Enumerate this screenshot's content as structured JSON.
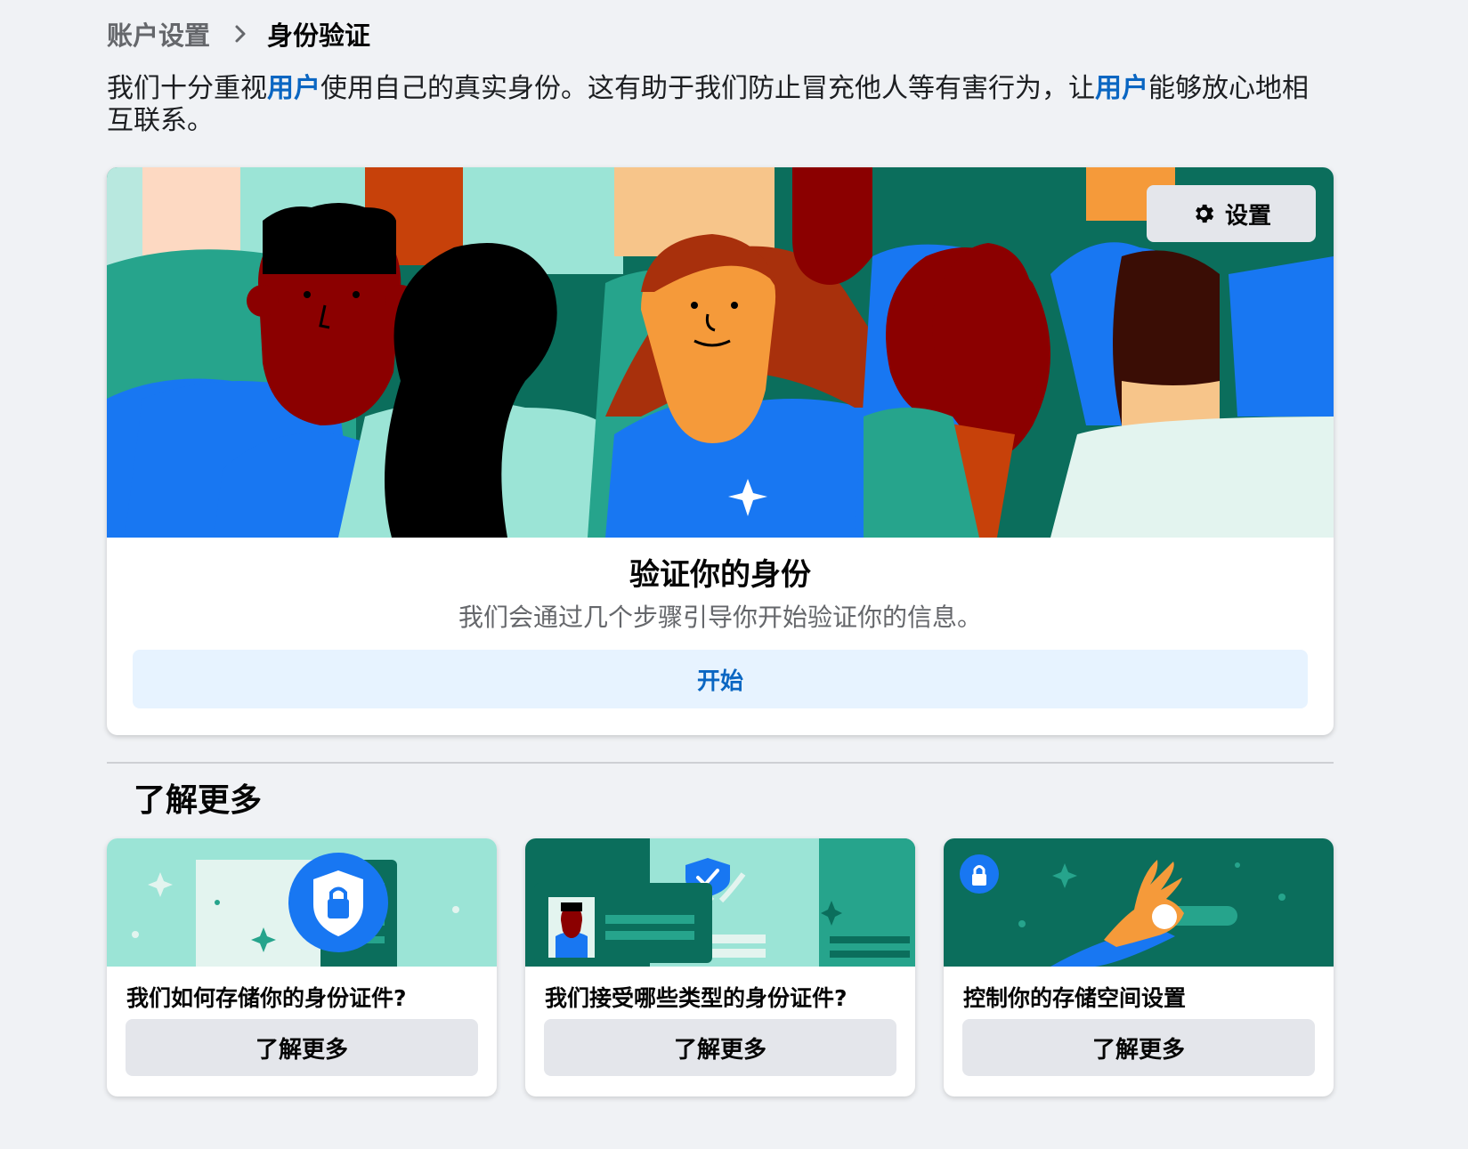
{
  "breadcrumb": {
    "parent": "账户设置",
    "current": "身份验证"
  },
  "intro": {
    "part1": "我们十分重视",
    "highlight1": "用户",
    "part2": "使用自己的真实身份。这有助于我们防止冒充他人等有害行为，让",
    "highlight2": "用户",
    "part3": "能够放心地相互联系。"
  },
  "hero": {
    "settings_label": "设置",
    "title": "验证你的身份",
    "subtitle": "我们会通过几个步骤引导你开始验证你的信息。",
    "start_label": "开始"
  },
  "learn_more": {
    "title": "了解更多",
    "cards": [
      {
        "title": "我们如何存储你的身份证件?",
        "button": "了解更多"
      },
      {
        "title": "我们接受哪些类型的身份证件?",
        "button": "了解更多"
      },
      {
        "title": "控制你的存储空间设置",
        "button": "了解更多"
      }
    ]
  },
  "colors": {
    "link": "#0a66c2",
    "page_bg": "#f0f2f5",
    "secondary_button": "#e4e6eb",
    "primary_light_button": "#e7f3ff"
  },
  "icons": {
    "breadcrumb_separator": "chevron-right-icon",
    "settings": "gear-icon",
    "card1": "shield-lock-icon",
    "card2": "verified-badge-icon",
    "card3": "lock-icon"
  }
}
